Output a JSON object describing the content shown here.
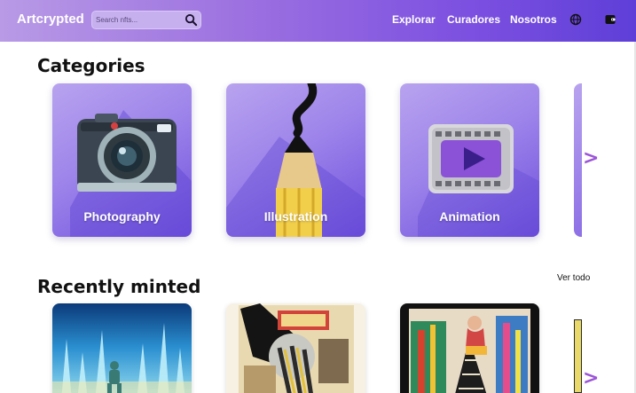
{
  "header": {
    "logo": "Artcrypted",
    "search": {
      "placeholder": "Search nfts..."
    },
    "nav": [
      {
        "label": "Explorar"
      },
      {
        "label": "Curadores"
      },
      {
        "label": "Nosotros"
      }
    ],
    "icons": [
      "search-icon",
      "globe-icon",
      "wallet-icon"
    ]
  },
  "categories": {
    "title": "Categories",
    "items": [
      {
        "label": "Photography",
        "icon": "camera-illustration"
      },
      {
        "label": "Illustration",
        "icon": "pencil-illustration"
      },
      {
        "label": "Animation",
        "icon": "film-play-illustration"
      }
    ],
    "next_icon": "chevron-right-icon"
  },
  "recently_minted": {
    "title": "Recently minted",
    "view_all": "Ver todo",
    "items": [
      {
        "art": "crystal-city-artwork"
      },
      {
        "art": "collage-artwork"
      },
      {
        "art": "boat-woman-artwork"
      }
    ],
    "next_icon": "chevron-right-icon"
  },
  "colors": {
    "header_gradient_start": "#b89ae6",
    "header_gradient_end": "#5e3fd8",
    "card_purple": "#9d84ea",
    "arrow": "#9b55d8"
  }
}
